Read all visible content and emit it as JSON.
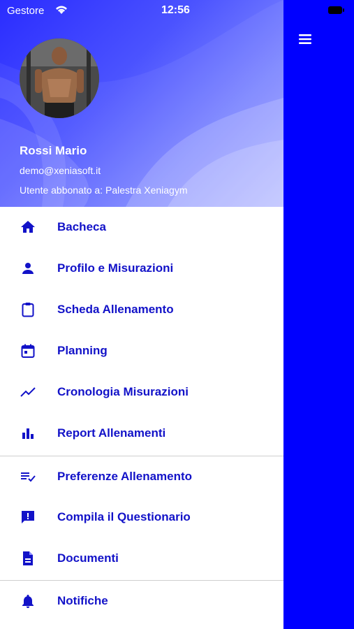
{
  "status_bar": {
    "carrier": "Gestore",
    "time": "12:56"
  },
  "drawer": {
    "user_name": "Rossi Mario",
    "user_email": "demo@xeniasoft.it",
    "subscription": "Utente abbonato a: Palestra Xeniagym",
    "sections": [
      {
        "items": [
          {
            "label": "Bacheca",
            "icon": "home-icon"
          },
          {
            "label": "Profilo e Misurazioni",
            "icon": "person-icon"
          },
          {
            "label": "Scheda Allenamento",
            "icon": "clipboard-icon"
          },
          {
            "label": "Planning",
            "icon": "calendar-icon"
          },
          {
            "label": "Cronologia Misurazioni",
            "icon": "trend-icon"
          },
          {
            "label": "Report Allenamenti",
            "icon": "bar-chart-icon"
          }
        ]
      },
      {
        "items": [
          {
            "label": "Preferenze Allenamento",
            "icon": "playlist-check-icon"
          },
          {
            "label": "Compila il Questionario",
            "icon": "feedback-icon"
          },
          {
            "label": "Documenti",
            "icon": "document-icon"
          }
        ]
      },
      {
        "items": [
          {
            "label": "Notifiche",
            "icon": "bell-icon"
          }
        ]
      }
    ]
  },
  "colors": {
    "accent": "#1212c8",
    "backdrop": "#0000ff",
    "header_start": "#2a2cff",
    "header_end": "#a8aeff"
  }
}
